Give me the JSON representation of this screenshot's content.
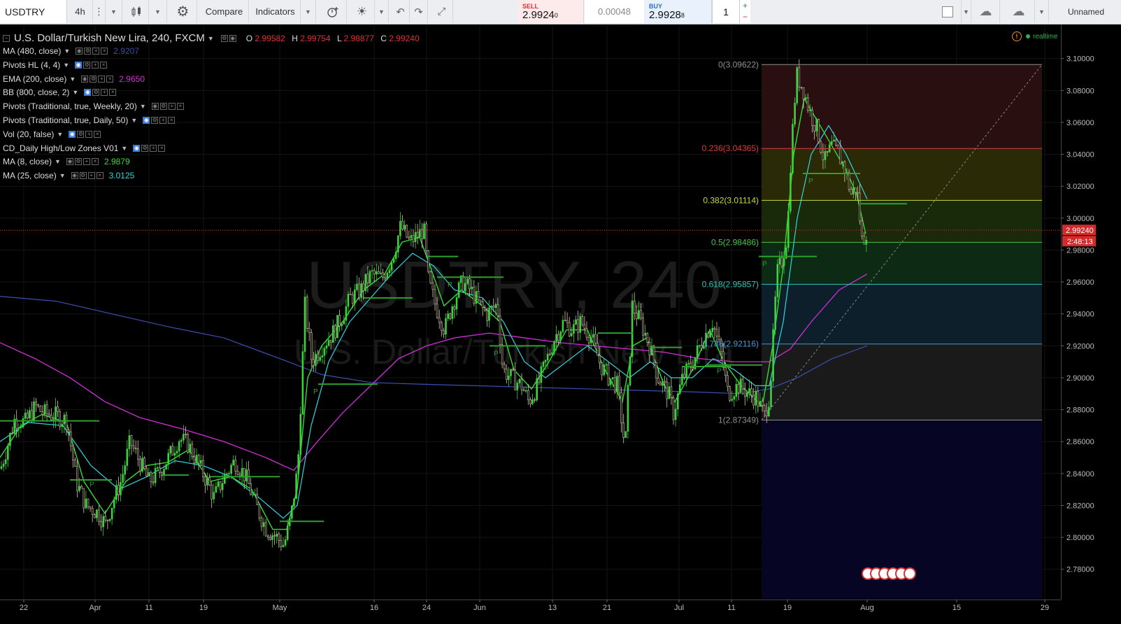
{
  "toolbar": {
    "symbol": "USDTRY",
    "interval": "4h",
    "compare_label": "Compare",
    "indicators_label": "Indicators",
    "sell_tag": "SELL",
    "sell_price": "2.9924",
    "sell_sup": "0",
    "spread": "0.00048",
    "buy_tag": "BUY",
    "buy_price": "2.9928",
    "buy_sup": "8",
    "quantity": "1",
    "layout_name": "Unnamed",
    "icons": [
      "crosshair-icon",
      "bars-icon",
      "gear-icon",
      "alert-icon",
      "light-icon",
      "undo-icon",
      "redo-icon",
      "fullscreen-icon",
      "cloud-download-icon",
      "cloud-upload-icon"
    ]
  },
  "legend": {
    "title": "U.S. Dollar/Turkish New Lira, 240, FXCM",
    "ohlc": {
      "o_label": "O",
      "o": "2.99582",
      "h_label": "H",
      "h": "2.99754",
      "l_label": "L",
      "l": "2.98877",
      "c_label": "C",
      "c": "2.99240"
    },
    "indicators": [
      {
        "label": "MA (480, close)",
        "value": "2.9207",
        "color": "#3c4fb0"
      },
      {
        "label": "Pivots HL (4, 4)",
        "value": "",
        "color": ""
      },
      {
        "label": "EMA (200, close)",
        "value": "2.9650",
        "color": "#d22fd6"
      },
      {
        "label": "BB (800, close, 2)",
        "value": "",
        "color": ""
      },
      {
        "label": "Pivots (Traditional, true, Weekly, 20)",
        "value": "",
        "color": ""
      },
      {
        "label": "Pivots (Traditional, true, Daily, 50)",
        "value": "",
        "color": ""
      },
      {
        "label": "Vol (20, false)",
        "value": "",
        "color": ""
      },
      {
        "label": "CD_Daily High/Low Zones V01",
        "value": "",
        "color": ""
      },
      {
        "label": "MA (8, close)",
        "value": "2.9879",
        "color": "#33dd33"
      },
      {
        "label": "MA (25, close)",
        "value": "3.0125",
        "color": "#30d5e0"
      }
    ],
    "realtime": "realtime"
  },
  "chart_data": {
    "type": "candlestick",
    "watermark_symbol": "USDTRY, 240",
    "watermark_name": "U.S. Dollar/Turkish New Lira",
    "x_tick_labels": [
      "22",
      "Apr",
      "11",
      "19",
      "May",
      "16",
      "24",
      "Jun",
      "13",
      "21",
      "Jul",
      "11",
      "19",
      "Aug",
      "15",
      "29"
    ],
    "y_tick_labels": [
      "3.10000",
      "3.08000",
      "3.06000",
      "3.04000",
      "3.02000",
      "3.00000",
      "2.98000",
      "2.96000",
      "2.94000",
      "2.92000",
      "2.90000",
      "2.88000",
      "2.86000",
      "2.84000",
      "2.82000",
      "2.80000",
      "2.78000"
    ],
    "ylim": [
      2.772,
      3.106
    ],
    "last_price": "2.99240",
    "countdown": "2:48:13",
    "close_path": [
      [
        0,
        2.843
      ],
      [
        10,
        2.858
      ],
      [
        20,
        2.874
      ],
      [
        35,
        2.872
      ],
      [
        50,
        2.882
      ],
      [
        60,
        2.878
      ],
      [
        80,
        2.876
      ],
      [
        95,
        2.873
      ],
      [
        108,
        2.835
      ],
      [
        122,
        2.82
      ],
      [
        140,
        2.815
      ],
      [
        150,
        2.808
      ],
      [
        160,
        2.822
      ],
      [
        172,
        2.835
      ],
      [
        185,
        2.86
      ],
      [
        198,
        2.848
      ],
      [
        212,
        2.835
      ],
      [
        225,
        2.84
      ],
      [
        240,
        2.85
      ],
      [
        255,
        2.862
      ],
      [
        268,
        2.858
      ],
      [
        280,
        2.848
      ],
      [
        295,
        2.835
      ],
      [
        305,
        2.825
      ],
      [
        320,
        2.838
      ],
      [
        335,
        2.848
      ],
      [
        350,
        2.838
      ],
      [
        365,
        2.82
      ],
      [
        380,
        2.805
      ],
      [
        395,
        2.8
      ],
      [
        405,
        2.795
      ],
      [
        415,
        2.812
      ],
      [
        425,
        2.845
      ],
      [
        435,
        2.945
      ],
      [
        445,
        2.91
      ],
      [
        460,
        2.92
      ],
      [
        475,
        2.928
      ],
      [
        490,
        2.94
      ],
      [
        500,
        2.95
      ],
      [
        515,
        2.955
      ],
      [
        530,
        2.965
      ],
      [
        545,
        2.962
      ],
      [
        560,
        2.975
      ],
      [
        572,
        2.995
      ],
      [
        585,
        2.985
      ],
      [
        598,
        2.99
      ],
      [
        605,
        2.993
      ],
      [
        612,
        2.96
      ],
      [
        622,
        2.945
      ],
      [
        635,
        2.93
      ],
      [
        645,
        2.945
      ],
      [
        660,
        2.96
      ],
      [
        672,
        2.955
      ],
      [
        685,
        2.945
      ],
      [
        695,
        2.94
      ],
      [
        710,
        2.946
      ],
      [
        718,
        2.905
      ],
      [
        730,
        2.9
      ],
      [
        745,
        2.895
      ],
      [
        755,
        2.885
      ],
      [
        768,
        2.895
      ],
      [
        780,
        2.91
      ],
      [
        792,
        2.925
      ],
      [
        805,
        2.935
      ],
      [
        818,
        2.93
      ],
      [
        830,
        2.935
      ],
      [
        845,
        2.925
      ],
      [
        858,
        2.908
      ],
      [
        870,
        2.9
      ],
      [
        882,
        2.895
      ],
      [
        893,
        2.855
      ],
      [
        903,
        2.945
      ],
      [
        915,
        2.935
      ],
      [
        928,
        2.92
      ],
      [
        940,
        2.9
      ],
      [
        955,
        2.89
      ],
      [
        962,
        2.878
      ],
      [
        975,
        2.9
      ],
      [
        990,
        2.91
      ],
      [
        1005,
        2.925
      ],
      [
        1018,
        2.935
      ],
      [
        1030,
        2.915
      ],
      [
        1040,
        2.89
      ],
      [
        1055,
        2.895
      ],
      [
        1070,
        2.89
      ],
      [
        1080,
        2.888
      ],
      [
        1092,
        2.876
      ],
      [
        1100,
        2.89
      ],
      [
        1110,
        2.965
      ],
      [
        1118,
        2.975
      ],
      [
        1125,
        2.99
      ],
      [
        1130,
        3.04
      ],
      [
        1138,
        3.09
      ],
      [
        1148,
        3.08
      ],
      [
        1158,
        3.065
      ],
      [
        1168,
        3.055
      ],
      [
        1178,
        3.035
      ],
      [
        1188,
        3.045
      ],
      [
        1198,
        3.04
      ],
      [
        1208,
        3.03
      ],
      [
        1216,
        3.015
      ],
      [
        1224,
        3.02
      ],
      [
        1232,
        2.985
      ],
      [
        1238,
        2.992
      ]
    ],
    "ma8_path": [
      [
        0,
        2.85
      ],
      [
        30,
        2.87
      ],
      [
        60,
        2.877
      ],
      [
        95,
        2.872
      ],
      [
        120,
        2.835
      ],
      [
        150,
        2.815
      ],
      [
        180,
        2.835
      ],
      [
        210,
        2.845
      ],
      [
        240,
        2.847
      ],
      [
        270,
        2.855
      ],
      [
        300,
        2.835
      ],
      [
        330,
        2.838
      ],
      [
        360,
        2.83
      ],
      [
        390,
        2.805
      ],
      [
        410,
        2.805
      ],
      [
        425,
        2.83
      ],
      [
        440,
        2.9
      ],
      [
        460,
        2.92
      ],
      [
        490,
        2.935
      ],
      [
        520,
        2.955
      ],
      [
        550,
        2.965
      ],
      [
        575,
        2.985
      ],
      [
        600,
        2.988
      ],
      [
        615,
        2.97
      ],
      [
        635,
        2.945
      ],
      [
        660,
        2.955
      ],
      [
        690,
        2.945
      ],
      [
        715,
        2.935
      ],
      [
        735,
        2.905
      ],
      [
        760,
        2.893
      ],
      [
        785,
        2.91
      ],
      [
        810,
        2.93
      ],
      [
        840,
        2.93
      ],
      [
        865,
        2.905
      ],
      [
        890,
        2.885
      ],
      [
        905,
        2.92
      ],
      [
        925,
        2.925
      ],
      [
        950,
        2.895
      ],
      [
        965,
        2.885
      ],
      [
        990,
        2.905
      ],
      [
        1015,
        2.93
      ],
      [
        1035,
        2.91
      ],
      [
        1060,
        2.895
      ],
      [
        1090,
        2.882
      ],
      [
        1105,
        2.92
      ],
      [
        1120,
        2.97
      ],
      [
        1135,
        3.04
      ],
      [
        1150,
        3.075
      ],
      [
        1170,
        3.06
      ],
      [
        1190,
        3.045
      ],
      [
        1210,
        3.03
      ],
      [
        1225,
        3.015
      ],
      [
        1238,
        2.99
      ]
    ],
    "ma25_path": [
      [
        0,
        2.86
      ],
      [
        40,
        2.872
      ],
      [
        90,
        2.87
      ],
      [
        130,
        2.845
      ],
      [
        170,
        2.83
      ],
      [
        210,
        2.838
      ],
      [
        250,
        2.848
      ],
      [
        290,
        2.845
      ],
      [
        330,
        2.838
      ],
      [
        370,
        2.825
      ],
      [
        405,
        2.812
      ],
      [
        425,
        2.82
      ],
      [
        445,
        2.87
      ],
      [
        470,
        2.91
      ],
      [
        500,
        2.935
      ],
      [
        530,
        2.95
      ],
      [
        560,
        2.965
      ],
      [
        590,
        2.978
      ],
      [
        620,
        2.97
      ],
      [
        650,
        2.955
      ],
      [
        690,
        2.95
      ],
      [
        720,
        2.935
      ],
      [
        750,
        2.91
      ],
      [
        780,
        2.9
      ],
      [
        810,
        2.91
      ],
      [
        840,
        2.92
      ],
      [
        870,
        2.91
      ],
      [
        900,
        2.9
      ],
      [
        930,
        2.91
      ],
      [
        960,
        2.9
      ],
      [
        990,
        2.9
      ],
      [
        1020,
        2.912
      ],
      [
        1050,
        2.905
      ],
      [
        1080,
        2.895
      ],
      [
        1100,
        2.895
      ],
      [
        1120,
        2.935
      ],
      [
        1140,
        3.0
      ],
      [
        1160,
        3.04
      ],
      [
        1185,
        3.058
      ],
      [
        1210,
        3.04
      ],
      [
        1240,
        3.012
      ]
    ],
    "ema200_path": [
      [
        0,
        2.922
      ],
      [
        50,
        2.912
      ],
      [
        100,
        2.9
      ],
      [
        150,
        2.885
      ],
      [
        200,
        2.875
      ],
      [
        260,
        2.868
      ],
      [
        320,
        2.86
      ],
      [
        380,
        2.85
      ],
      [
        420,
        2.842
      ],
      [
        450,
        2.858
      ],
      [
        490,
        2.878
      ],
      [
        530,
        2.895
      ],
      [
        570,
        2.912
      ],
      [
        610,
        2.92
      ],
      [
        650,
        2.925
      ],
      [
        700,
        2.928
      ],
      [
        750,
        2.925
      ],
      [
        800,
        2.922
      ],
      [
        850,
        2.92
      ],
      [
        900,
        2.918
      ],
      [
        950,
        2.916
      ],
      [
        1000,
        2.912
      ],
      [
        1050,
        2.91
      ],
      [
        1100,
        2.91
      ],
      [
        1130,
        2.918
      ],
      [
        1160,
        2.935
      ],
      [
        1200,
        2.955
      ],
      [
        1240,
        2.965
      ]
    ],
    "ma480_path": [
      [
        0,
        2.951
      ],
      [
        80,
        2.948
      ],
      [
        160,
        2.94
      ],
      [
        240,
        2.932
      ],
      [
        320,
        2.925
      ],
      [
        400,
        2.912
      ],
      [
        460,
        2.902
      ],
      [
        530,
        2.897
      ],
      [
        600,
        2.896
      ],
      [
        680,
        2.895
      ],
      [
        760,
        2.894
      ],
      [
        840,
        2.893
      ],
      [
        920,
        2.892
      ],
      [
        1000,
        2.891
      ],
      [
        1060,
        2.89
      ],
      [
        1100,
        2.893
      ],
      [
        1140,
        2.9
      ],
      [
        1190,
        2.912
      ],
      [
        1240,
        2.92
      ]
    ],
    "fibonacci": {
      "levels": [
        {
          "label": "0(3.09622)",
          "price": 3.09622,
          "color": "#8f8f8f",
          "fill": "#2a0f10"
        },
        {
          "label": "0.236(3.04365)",
          "price": 3.04365,
          "color": "#e03a3a",
          "fill": "#2a2a06"
        },
        {
          "label": "0.382(3.01114)",
          "price": 3.01114,
          "color": "#c8d840",
          "fill": "#182a0a"
        },
        {
          "label": "0.5(2.98486)",
          "price": 2.98486,
          "color": "#4ac24a",
          "fill": "#0c2a14"
        },
        {
          "label": "0.618(2.95857)",
          "price": 2.95857,
          "color": "#31c4b8",
          "fill": "#0d1f2a"
        },
        {
          "label": "0.786(2.92116)",
          "price": 2.92116,
          "color": "#3a9ad6",
          "fill": "#1a1a1a"
        },
        {
          "label": "1(2.87349)",
          "price": 2.87349,
          "color": "#8f8f8f",
          "fill": "#060624"
        }
      ]
    },
    "pivot_label": "P",
    "event_badge": "",
    "colors": {
      "candle_up": "#3fd03f",
      "candle_down": "#d8c7a8",
      "ma8": "#33dd33",
      "ma25": "#30d5e0",
      "ema200": "#d22fd6",
      "ma480": "#3c4fb0",
      "price_line": "#e03131"
    }
  }
}
